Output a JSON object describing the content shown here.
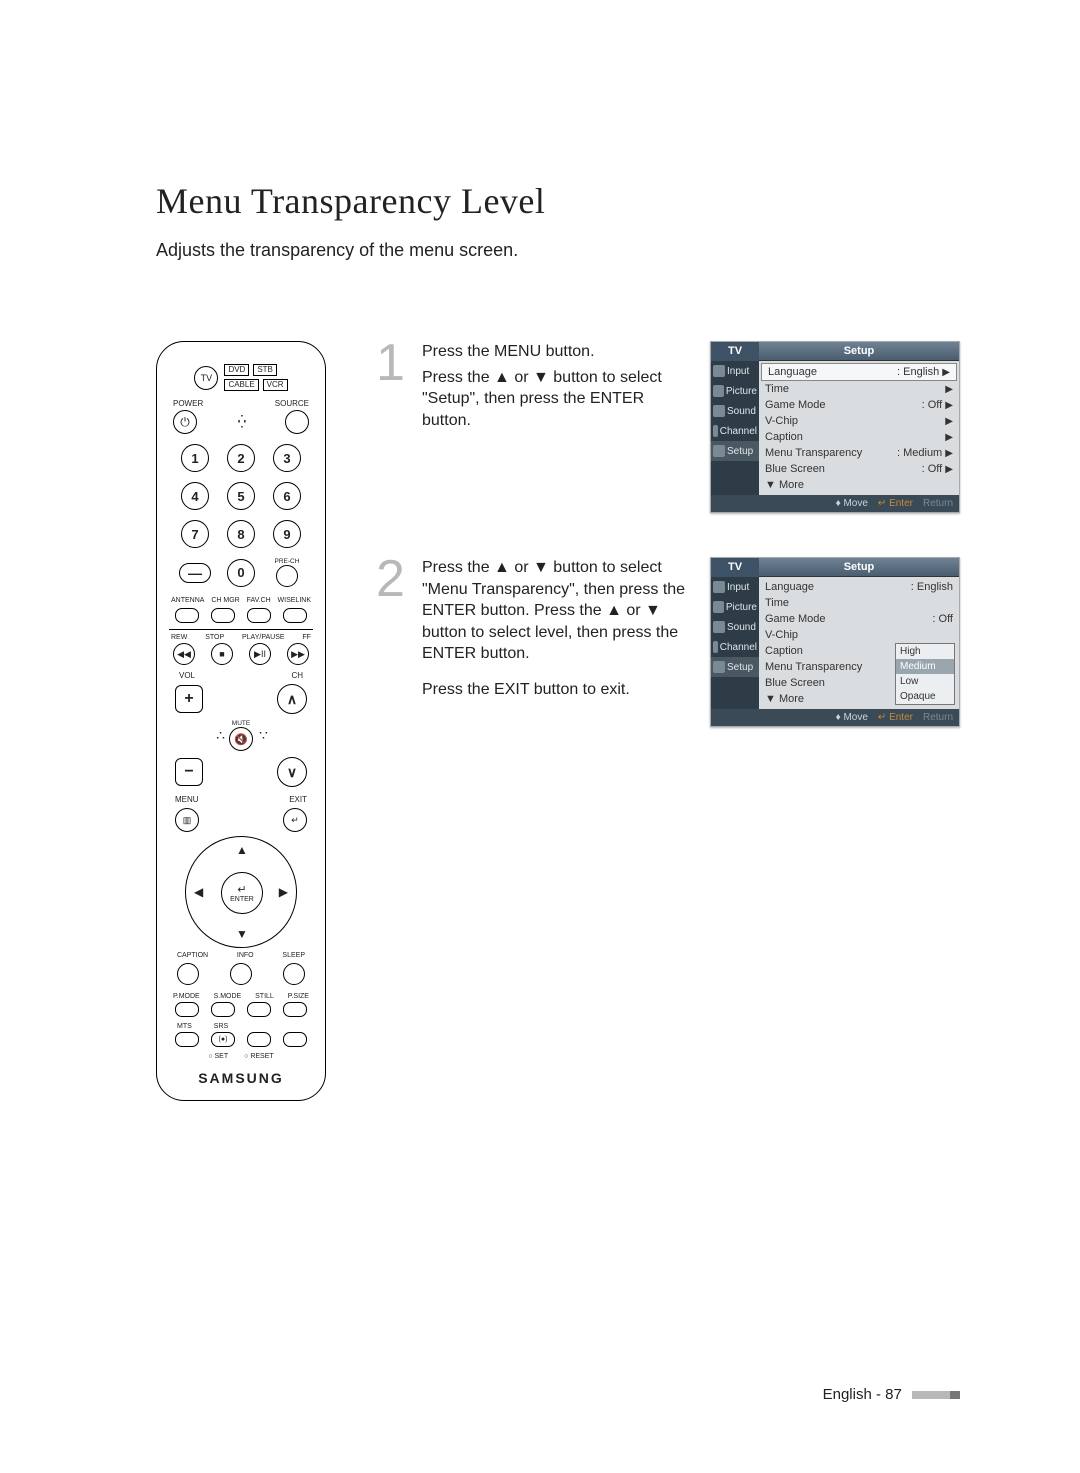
{
  "page": {
    "title": "Menu Transparency Level",
    "subtitle": "Adjusts the transparency of the menu screen.",
    "footer": "English - 87"
  },
  "remote": {
    "brand": "SAMSUNG",
    "top_modes": {
      "tv": "TV",
      "dvd": "DVD",
      "stb": "STB",
      "cable": "CABLE",
      "vcr": "VCR"
    },
    "power": "POWER",
    "source": "SOURCE",
    "prech": "PRE-CH",
    "row_labels": [
      "ANTENNA",
      "CH MGR",
      "FAV.CH",
      "WISELINK"
    ],
    "playback_labels": [
      "REW",
      "STOP",
      "PLAY/PAUSE",
      "FF"
    ],
    "vol": "VOL",
    "ch": "CH",
    "mute": "MUTE",
    "menu": "MENU",
    "exit": "EXIT",
    "enter": "ENTER",
    "cap_row": [
      "CAPTION",
      "INFO",
      "SLEEP"
    ],
    "mode_row": [
      "P.MODE",
      "S.MODE",
      "STILL",
      "P.SIZE"
    ],
    "mts_row": [
      "MTS",
      "SRS"
    ],
    "set": "SET",
    "reset": "RESET",
    "numbers": [
      "1",
      "2",
      "3",
      "4",
      "5",
      "6",
      "7",
      "8",
      "9",
      "0"
    ]
  },
  "steps": [
    {
      "num": "1",
      "lines": [
        "Press the MENU button.",
        "Press the ▲ or ▼ button to select \"Setup\", then press the ENTER button."
      ]
    },
    {
      "num": "2",
      "lines": [
        "Press the ▲ or ▼ button to select \"Menu Transparency\", then press the ENTER button. Press the ▲ or ▼ button to select level, then press the ENTER button.",
        "Press the EXIT button to exit."
      ]
    }
  ],
  "osd1": {
    "tv": "TV",
    "title": "Setup",
    "side": [
      "Input",
      "Picture",
      "Sound",
      "Channel",
      "Setup"
    ],
    "rows": [
      {
        "label": "Language",
        "value": ": English",
        "hl": true
      },
      {
        "label": "Time",
        "value": ""
      },
      {
        "label": "Game Mode",
        "value": ": Off"
      },
      {
        "label": "V-Chip",
        "value": ""
      },
      {
        "label": "Caption",
        "value": ""
      },
      {
        "label": "Menu Transparency",
        "value": ": Medium"
      },
      {
        "label": "Blue Screen",
        "value": ": Off"
      },
      {
        "label": "▼ More",
        "value": ""
      }
    ],
    "foot": {
      "move": "Move",
      "enter": "Enter",
      "return": "Return"
    }
  },
  "osd2": {
    "tv": "TV",
    "title": "Setup",
    "side": [
      "Input",
      "Picture",
      "Sound",
      "Channel",
      "Setup"
    ],
    "rows": [
      {
        "label": "Language",
        "value": ": English"
      },
      {
        "label": "Time",
        "value": ""
      },
      {
        "label": "Game Mode",
        "value": ": Off"
      },
      {
        "label": "V-Chip",
        "value": ""
      },
      {
        "label": "Caption",
        "value": ""
      },
      {
        "label": "Menu Transparency",
        "value": ""
      },
      {
        "label": "Blue Screen",
        "value": ""
      },
      {
        "label": "▼ More",
        "value": ""
      }
    ],
    "submenu": [
      "High",
      "Medium",
      "Low",
      "Opaque"
    ],
    "submenu_sel": 1,
    "foot": {
      "move": "Move",
      "enter": "Enter",
      "return": "Return"
    }
  }
}
